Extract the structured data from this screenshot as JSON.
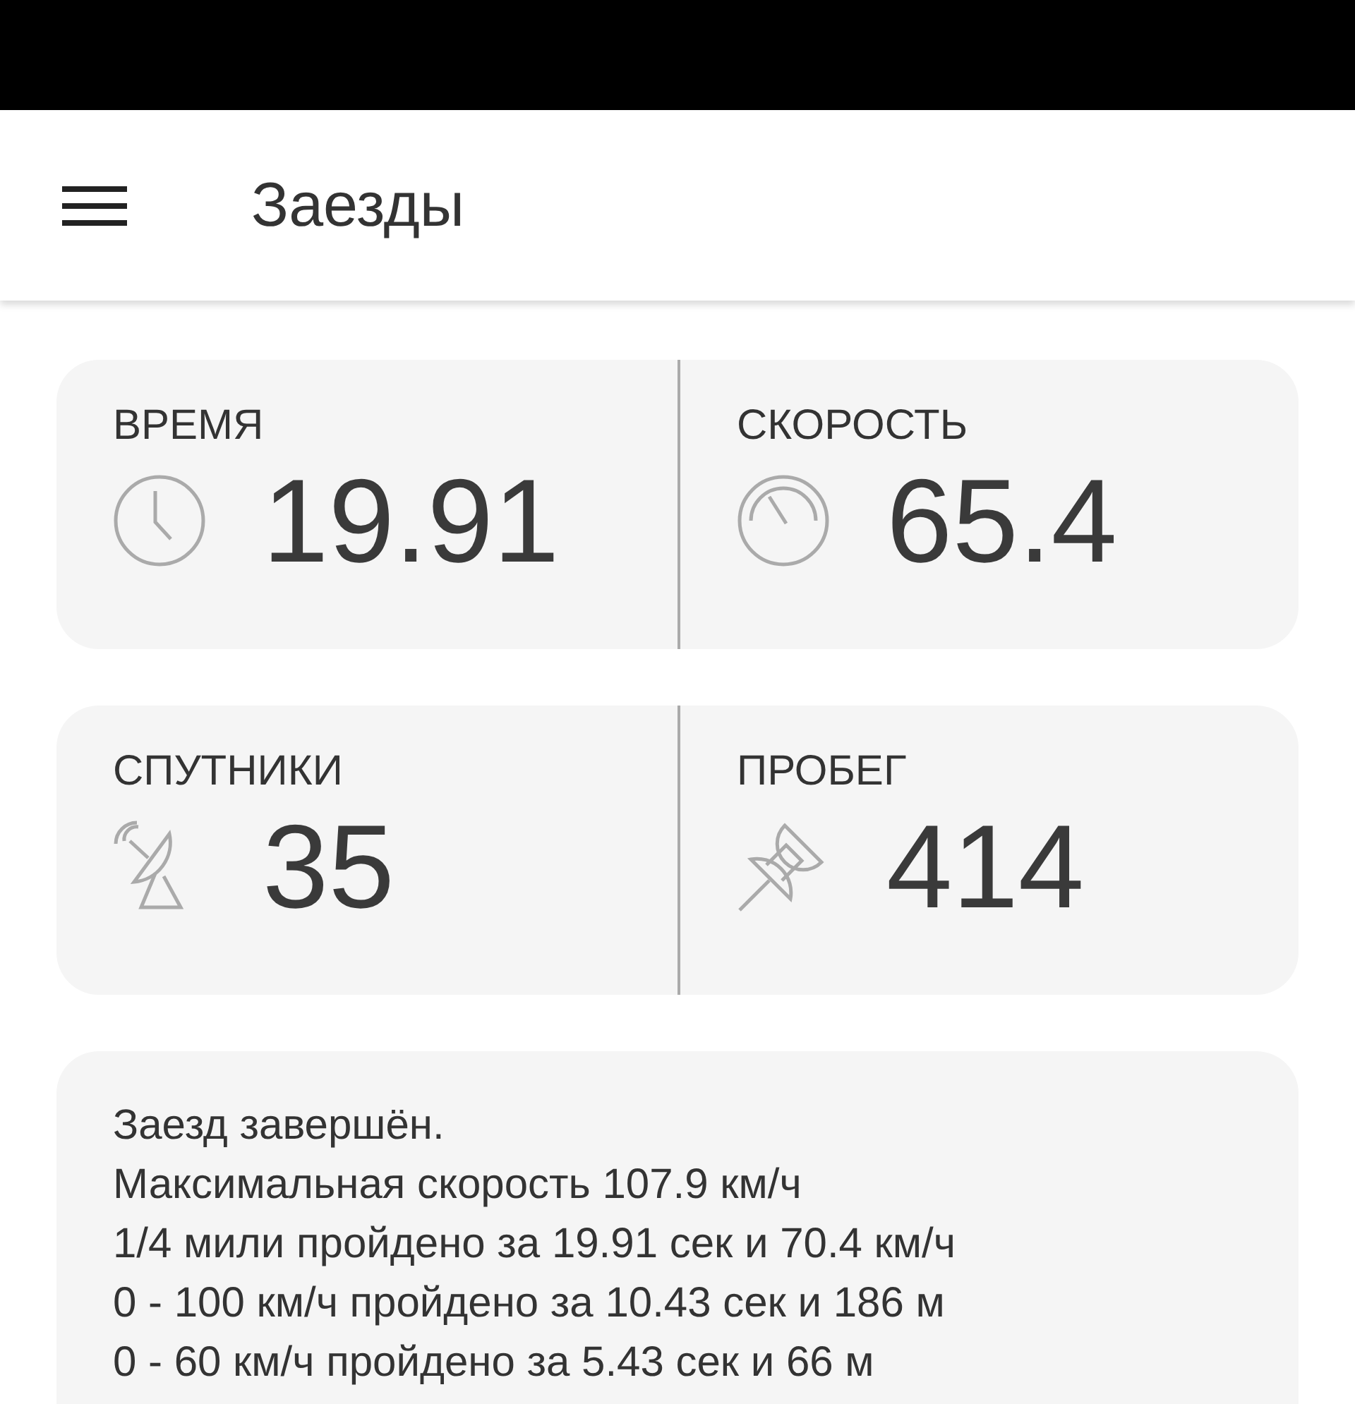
{
  "app_bar": {
    "title": "Заезды"
  },
  "stat_rows": [
    [
      {
        "label": "ВРЕМЯ",
        "value": "19.91"
      },
      {
        "label": "СКОРОСТЬ",
        "value": "65.4"
      }
    ],
    [
      {
        "label": "СПУТНИКИ",
        "value": "35"
      },
      {
        "label": "ПРОБЕГ",
        "value": "414"
      }
    ]
  ],
  "summary_lines": [
    "Заезд завершён.",
    "Максимальная скорость 107.9 км/ч",
    "1/4 мили пройдено за 19.91 сек и 70.4 км/ч",
    "0 - 100 км/ч пройдено за 10.43 сек и 186 м",
    "0 - 60 км/ч пройдено за 5.43 сек и 66 м"
  ]
}
